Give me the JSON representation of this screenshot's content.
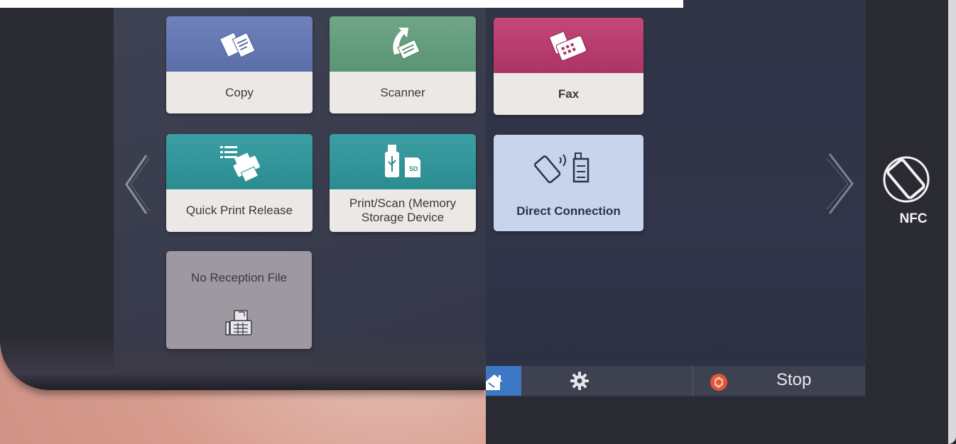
{
  "tiles": {
    "copy": {
      "label": "Copy"
    },
    "scanner": {
      "label": "Scanner"
    },
    "fax": {
      "label": "Fax"
    },
    "quick_print": {
      "label": "Quick Print Release"
    },
    "print_scan": {
      "label": "Print/Scan (Memory Storage Device"
    },
    "direct_connection": {
      "label": "Direct Connection"
    },
    "no_reception": {
      "label": "No Reception File"
    }
  },
  "sd_badge": "SD",
  "nfc": {
    "label": "NFC"
  },
  "bottom_bar": {
    "stop_label": "Stop"
  },
  "icons": {
    "prev": "chevron-left-icon",
    "next": "chevron-right-icon",
    "settings": "gear-icon",
    "stop": "stop-icon",
    "nfc": "nfc-phone-icon"
  },
  "colors": {
    "copy": "#6f82bb",
    "scanner": "#6fa786",
    "fax": "#c4477a",
    "quick_print": "#3a9fa3",
    "print_scan": "#3a9fa3",
    "direct_connection": "#c7d4ec",
    "no_reception": "#9e98a0",
    "stop": "#e2553b"
  }
}
